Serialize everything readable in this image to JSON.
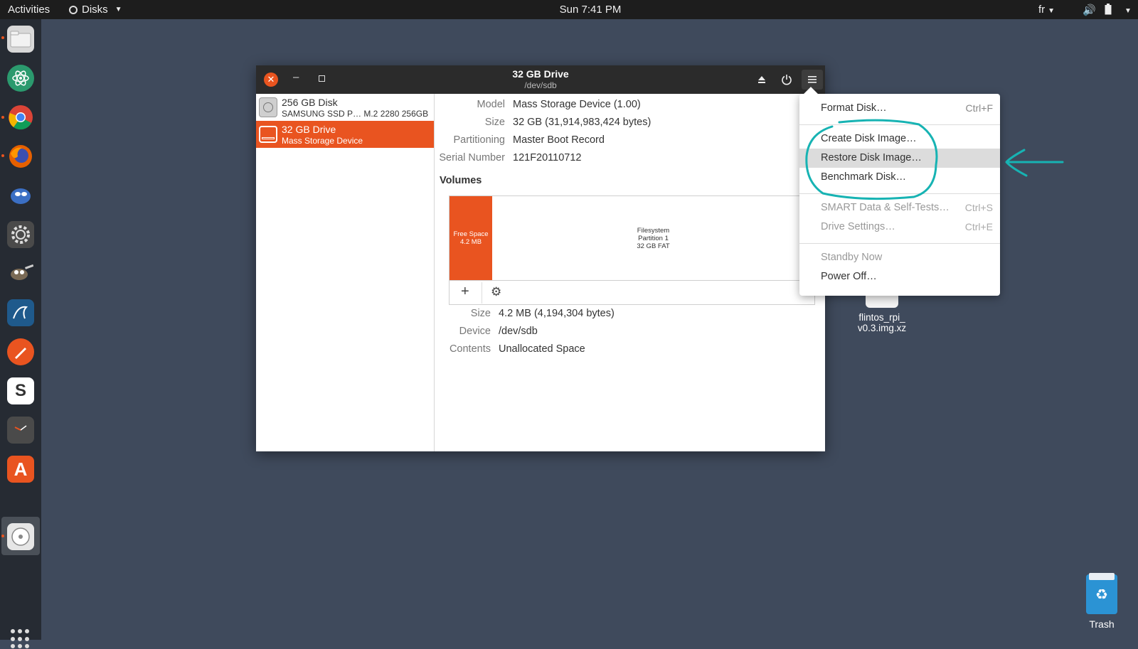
{
  "topbar": {
    "activities": "Activities",
    "app_name": "Disks",
    "clock": "Sun  7:41 PM",
    "lang": "fr"
  },
  "dock": {
    "apps": [
      "files",
      "atom",
      "chrome",
      "firefox",
      "remmina",
      "settings",
      "gimp",
      "mysql-workbench",
      "inkscape",
      "slack",
      "clock",
      "software-center",
      "disks"
    ]
  },
  "desktop": {
    "file_label_line1": "flintos_rpi_",
    "file_label_line2": "v0.3.img.xz",
    "trash_label": "Trash"
  },
  "window": {
    "title": "32 GB Drive",
    "subtitle": "/dev/sdb"
  },
  "sidebar": {
    "drives": [
      {
        "name": "256 GB Disk",
        "desc": "SAMSUNG SSD P… M.2 2280 256GB"
      },
      {
        "name": "32 GB Drive",
        "desc": "Mass Storage Device"
      }
    ]
  },
  "drive_info": {
    "model_label": "Model",
    "model_value": "Mass Storage Device (1.00)",
    "size_label": "Size",
    "size_value": "32 GB (31,914,983,424 bytes)",
    "partitioning_label": "Partitioning",
    "partitioning_value": "Master Boot Record",
    "serial_label": "Serial Number",
    "serial_value": "121F20110712"
  },
  "volumes": {
    "heading": "Volumes",
    "free_line1": "Free Space",
    "free_line2": "4.2 MB",
    "fs_line1": "Filesystem",
    "fs_line2": "Partition 1",
    "fs_line3": "32 GB FAT"
  },
  "volume_info": {
    "size_label": "Size",
    "size_value": "4.2 MB (4,194,304 bytes)",
    "device_label": "Device",
    "device_value": "/dev/sdb",
    "contents_label": "Contents",
    "contents_value": "Unallocated Space"
  },
  "menu": {
    "items": [
      {
        "label": "Format Disk…",
        "shortcut": "Ctrl+F"
      },
      {
        "label": "Create Disk Image…",
        "shortcut": ""
      },
      {
        "label": "Restore Disk Image…",
        "shortcut": ""
      },
      {
        "label": "Benchmark Disk…",
        "shortcut": ""
      },
      {
        "label": "SMART Data & Self-Tests…",
        "shortcut": "Ctrl+S"
      },
      {
        "label": "Drive Settings…",
        "shortcut": "Ctrl+E"
      },
      {
        "label": "Standby Now",
        "shortcut": ""
      },
      {
        "label": "Power Off…",
        "shortcut": ""
      }
    ]
  },
  "colors": {
    "accent": "#e95420",
    "annotation": "#17b3b3",
    "desktop": "#3f4a5c"
  }
}
